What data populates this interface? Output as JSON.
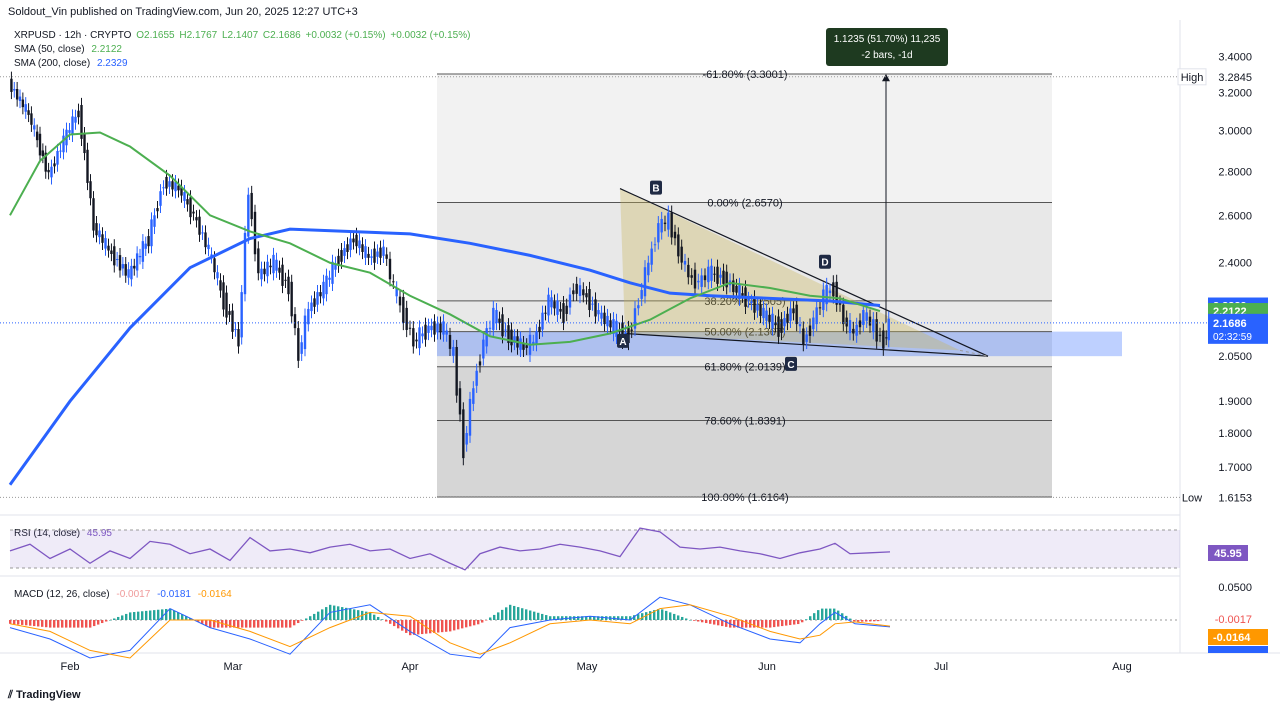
{
  "header": {
    "publisher": "Soldout_Vin published on TradingView.com, Jun 20, 2025 12:27 UTC+3"
  },
  "symbol": {
    "title": "XRPUSD · 12h · CRYPTO",
    "open": "O2.1655",
    "high": "H2.1767",
    "low": "L2.1407",
    "close": "C2.1686",
    "change": "+0.0032 (+0.15%)",
    "change2": "+0.0032 (+0.15%)"
  },
  "indicators": {
    "sma50": {
      "label": "SMA (50, close)",
      "value": "2.2122",
      "color": "#4caf50"
    },
    "sma200": {
      "label": "SMA (200, close)",
      "value": "2.2329",
      "color": "#2962ff"
    },
    "rsi": {
      "label": "RSI (14, close)",
      "value": "45.95"
    },
    "macd": {
      "label": "MACD (12, 26, close)",
      "v1": "-0.0017",
      "v2": "-0.0181",
      "v3": "-0.0164"
    }
  },
  "measure_box": {
    "line1": "1.1235 (51.70%) 11,235",
    "line2": "-2 bars, -1d"
  },
  "price_axis": {
    "ticks": [
      "3.4000",
      "3.2000",
      "3.0000",
      "2.8000",
      "2.6000",
      "2.4000",
      "2.0500",
      "1.9000",
      "1.8000",
      "1.7000"
    ],
    "high_label": "High",
    "high_value": "3.2845",
    "low_label": "Low",
    "low_value": "1.6153",
    "sma200_tag": "2.2329",
    "sma50_tag": "2.2122",
    "price_tag": "2.1686",
    "countdown": "02:32:59",
    "rsi_tag": "45.95",
    "macd_ticks": [
      "0.0500"
    ],
    "macd_tag1": "-0.0017",
    "macd_tag2": "-0.0164"
  },
  "time_axis": [
    "Feb",
    "Mar",
    "Apr",
    "May",
    "Jun",
    "Jul",
    "Aug"
  ],
  "fib_levels": [
    {
      "label": "-61.80% (3.3001)"
    },
    {
      "label": "0.00% (2.6570)"
    },
    {
      "label": "38.20% (2.2505)"
    },
    {
      "label": "50.00% (2.1367)"
    },
    {
      "label": "61.80% (2.0139)"
    },
    {
      "label": "78.60% (1.8391)"
    },
    {
      "label": "100.00% (1.6164)"
    }
  ],
  "pattern_points": [
    "A",
    "B",
    "C",
    "D"
  ],
  "colors": {
    "sma50": "#4caf50",
    "sma200": "#2962ff",
    "up": "#2962ff",
    "down": "#131722",
    "rsi": "#7e57c2",
    "macd": "#2962ff",
    "signal": "#ff9800",
    "hist_pos": "#26a69a",
    "hist_neg": "#ef5350"
  },
  "footer": {
    "brand": "TradingView"
  },
  "chart_data": {
    "type": "candlestick",
    "symbol": "XRPUSD",
    "timeframe": "12h",
    "ylim": [
      1.55,
      3.45
    ],
    "y_log_scale": true,
    "x_ticks": [
      "Feb",
      "Mar",
      "Apr",
      "May",
      "Jun",
      "Jul",
      "Aug"
    ],
    "high": 3.2845,
    "low": 1.6153,
    "last_close": 2.1686,
    "fibonacci": [
      {
        "level": "-61.80%",
        "price": 3.3001
      },
      {
        "level": "0.00%",
        "price": 2.657
      },
      {
        "level": "38.20%",
        "price": 2.2505
      },
      {
        "level": "50.00%",
        "price": 2.1367
      },
      {
        "level": "61.80%",
        "price": 2.0139
      },
      {
        "level": "78.60%",
        "price": 1.8391
      },
      {
        "level": "100.00%",
        "price": 1.6164
      }
    ],
    "series": [
      {
        "name": "SMA (50, close)",
        "last": 2.2122
      },
      {
        "name": "SMA (200, close)",
        "last": 2.2329
      }
    ],
    "price_path": [
      [
        0,
        3.25
      ],
      [
        20,
        3.08
      ],
      [
        40,
        2.78
      ],
      [
        55,
        2.95
      ],
      [
        70,
        3.1
      ],
      [
        85,
        2.55
      ],
      [
        100,
        2.45
      ],
      [
        120,
        2.35
      ],
      [
        140,
        2.5
      ],
      [
        155,
        2.75
      ],
      [
        170,
        2.72
      ],
      [
        185,
        2.6
      ],
      [
        200,
        2.45
      ],
      [
        215,
        2.25
      ],
      [
        230,
        2.1
      ],
      [
        240,
        2.7
      ],
      [
        250,
        2.35
      ],
      [
        265,
        2.4
      ],
      [
        280,
        2.3
      ],
      [
        290,
        2.05
      ],
      [
        300,
        2.22
      ],
      [
        315,
        2.3
      ],
      [
        330,
        2.42
      ],
      [
        345,
        2.5
      ],
      [
        360,
        2.42
      ],
      [
        375,
        2.45
      ],
      [
        385,
        2.3
      ],
      [
        395,
        2.2
      ],
      [
        405,
        2.1
      ],
      [
        420,
        2.15
      ],
      [
        435,
        2.15
      ],
      [
        445,
        2.05
      ],
      [
        455,
        1.75
      ],
      [
        465,
        1.95
      ],
      [
        475,
        2.1
      ],
      [
        485,
        2.2
      ],
      [
        500,
        2.12
      ],
      [
        515,
        2.08
      ],
      [
        525,
        2.1
      ],
      [
        540,
        2.25
      ],
      [
        555,
        2.2
      ],
      [
        565,
        2.3
      ],
      [
        575,
        2.28
      ],
      [
        590,
        2.2
      ],
      [
        605,
        2.15
      ],
      [
        620,
        2.12
      ],
      [
        630,
        2.25
      ],
      [
        640,
        2.4
      ],
      [
        650,
        2.55
      ],
      [
        660,
        2.58
      ],
      [
        670,
        2.45
      ],
      [
        680,
        2.35
      ],
      [
        690,
        2.32
      ],
      [
        700,
        2.36
      ],
      [
        715,
        2.34
      ],
      [
        725,
        2.3
      ],
      [
        740,
        2.25
      ],
      [
        755,
        2.2
      ],
      [
        770,
        2.15
      ],
      [
        785,
        2.22
      ],
      [
        795,
        2.1
      ],
      [
        805,
        2.18
      ],
      [
        815,
        2.27
      ],
      [
        825,
        2.3
      ],
      [
        835,
        2.18
      ],
      [
        845,
        2.13
      ],
      [
        855,
        2.2
      ],
      [
        865,
        2.15
      ],
      [
        875,
        2.1
      ],
      [
        880,
        2.16
      ]
    ],
    "rsi_path": [
      [
        0,
        48
      ],
      [
        20,
        55
      ],
      [
        40,
        40
      ],
      [
        60,
        50
      ],
      [
        80,
        35
      ],
      [
        100,
        48
      ],
      [
        120,
        40
      ],
      [
        140,
        58
      ],
      [
        160,
        55
      ],
      [
        180,
        45
      ],
      [
        200,
        50
      ],
      [
        220,
        38
      ],
      [
        240,
        62
      ],
      [
        260,
        48
      ],
      [
        280,
        50
      ],
      [
        300,
        46
      ],
      [
        320,
        52
      ],
      [
        340,
        55
      ],
      [
        360,
        48
      ],
      [
        380,
        50
      ],
      [
        400,
        40
      ],
      [
        420,
        45
      ],
      [
        440,
        35
      ],
      [
        455,
        28
      ],
      [
        470,
        45
      ],
      [
        490,
        52
      ],
      [
        510,
        48
      ],
      [
        530,
        50
      ],
      [
        550,
        55
      ],
      [
        570,
        52
      ],
      [
        590,
        48
      ],
      [
        610,
        42
      ],
      [
        630,
        72
      ],
      [
        650,
        68
      ],
      [
        670,
        52
      ],
      [
        690,
        50
      ],
      [
        710,
        52
      ],
      [
        730,
        48
      ],
      [
        750,
        45
      ],
      [
        770,
        40
      ],
      [
        790,
        46
      ],
      [
        810,
        50
      ],
      [
        825,
        56
      ],
      [
        840,
        45
      ],
      [
        860,
        46
      ],
      [
        880,
        47
      ]
    ],
    "macd_path": [
      [
        0,
        -0.02
      ],
      [
        40,
        -0.05
      ],
      [
        80,
        -0.1
      ],
      [
        120,
        -0.08
      ],
      [
        160,
        0.03
      ],
      [
        200,
        -0.02
      ],
      [
        240,
        -0.05
      ],
      [
        280,
        -0.09
      ],
      [
        320,
        0.02
      ],
      [
        360,
        0.04
      ],
      [
        400,
        -0.03
      ],
      [
        440,
        -0.09
      ],
      [
        470,
        -0.1
      ],
      [
        500,
        -0.02
      ],
      [
        540,
        0.0
      ],
      [
        580,
        0.01
      ],
      [
        620,
        0.0
      ],
      [
        650,
        0.06
      ],
      [
        680,
        0.04
      ],
      [
        720,
        -0.01
      ],
      [
        760,
        -0.05
      ],
      [
        790,
        -0.06
      ],
      [
        810,
        -0.01
      ],
      [
        825,
        0.02
      ],
      [
        845,
        -0.01
      ],
      [
        880,
        -0.018
      ]
    ],
    "signal_path": [
      [
        0,
        -0.01
      ],
      [
        40,
        -0.03
      ],
      [
        80,
        -0.08
      ],
      [
        120,
        -0.1
      ],
      [
        160,
        0.0
      ],
      [
        200,
        0.0
      ],
      [
        240,
        -0.03
      ],
      [
        280,
        -0.07
      ],
      [
        320,
        -0.02
      ],
      [
        360,
        0.02
      ],
      [
        400,
        0.01
      ],
      [
        440,
        -0.06
      ],
      [
        470,
        -0.09
      ],
      [
        500,
        -0.06
      ],
      [
        540,
        -0.01
      ],
      [
        580,
        0.0
      ],
      [
        620,
        -0.01
      ],
      [
        650,
        0.03
      ],
      [
        680,
        0.04
      ],
      [
        720,
        0.01
      ],
      [
        760,
        -0.03
      ],
      [
        790,
        -0.05
      ],
      [
        810,
        -0.04
      ],
      [
        825,
        -0.01
      ],
      [
        845,
        -0.005
      ],
      [
        880,
        -0.016
      ]
    ]
  }
}
